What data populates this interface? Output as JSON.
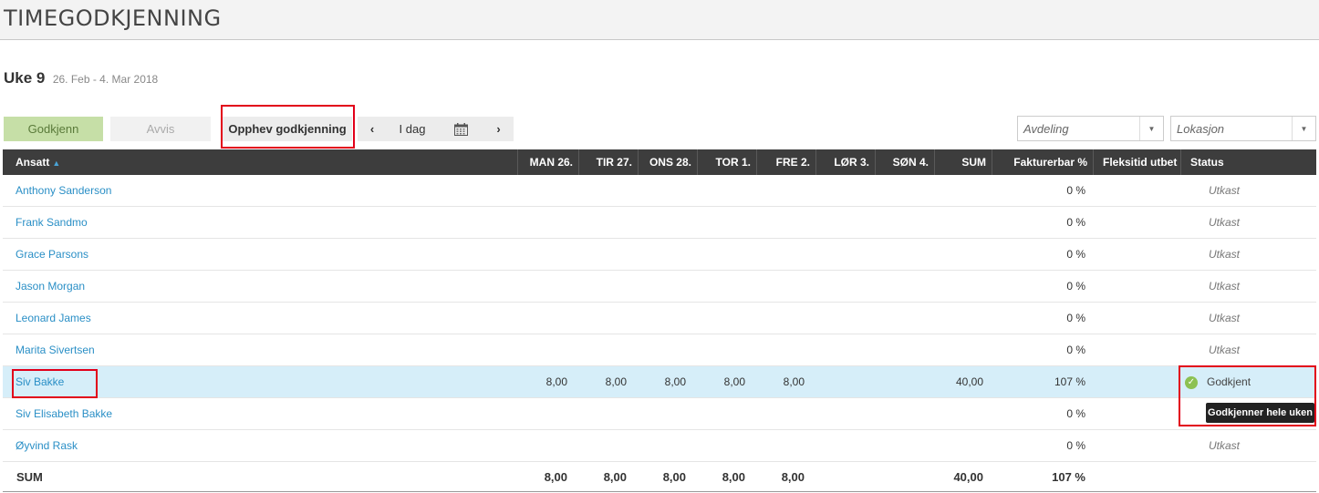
{
  "header": {
    "title": "TIMEGODKJENNING"
  },
  "week": {
    "label": "Uke 9",
    "range": "26. Feb - 4. Mar 2018"
  },
  "toolbar": {
    "approve": "Godkjenn",
    "reject": "Avvis",
    "unapprove": "Opphev godkjenning",
    "prev": "‹",
    "today": "I dag",
    "next": "›"
  },
  "filters": {
    "department_placeholder": "Avdeling",
    "location_placeholder": "Lokasjon"
  },
  "columns": {
    "employee": "Ansatt",
    "mon": "MAN 26.",
    "tue": "TIR 27.",
    "wed": "ONS 28.",
    "thu": "TOR 1.",
    "fri": "FRE 2.",
    "sat": "LØR 3.",
    "sun": "SØN 4.",
    "sum": "SUM",
    "billable": "Fakturerbar %",
    "flex": "Fleksitid utbet",
    "status": "Status"
  },
  "rows": [
    {
      "name": "Anthony Sanderson",
      "mon": "",
      "tue": "",
      "wed": "",
      "thu": "",
      "fri": "",
      "sum": "",
      "billable": "0 %",
      "status": "Utkast"
    },
    {
      "name": "Frank Sandmo",
      "mon": "",
      "tue": "",
      "wed": "",
      "thu": "",
      "fri": "",
      "sum": "",
      "billable": "0 %",
      "status": "Utkast"
    },
    {
      "name": "Grace Parsons",
      "mon": "",
      "tue": "",
      "wed": "",
      "thu": "",
      "fri": "",
      "sum": "",
      "billable": "0 %",
      "status": "Utkast"
    },
    {
      "name": "Jason Morgan",
      "mon": "",
      "tue": "",
      "wed": "",
      "thu": "",
      "fri": "",
      "sum": "",
      "billable": "0 %",
      "status": "Utkast"
    },
    {
      "name": "Leonard James",
      "mon": "",
      "tue": "",
      "wed": "",
      "thu": "",
      "fri": "",
      "sum": "",
      "billable": "0 %",
      "status": "Utkast"
    },
    {
      "name": "Marita Sivertsen",
      "mon": "",
      "tue": "",
      "wed": "",
      "thu": "",
      "fri": "",
      "sum": "",
      "billable": "0 %",
      "status": "Utkast"
    },
    {
      "name": "Siv Bakke",
      "mon": "8,00",
      "tue": "8,00",
      "wed": "8,00",
      "thu": "8,00",
      "fri": "8,00",
      "sum": "40,00",
      "billable": "107 %",
      "status": "Godkjent"
    },
    {
      "name": "Siv Elisabeth Bakke",
      "mon": "",
      "tue": "",
      "wed": "",
      "thu": "",
      "fri": "",
      "sum": "",
      "billable": "0 %",
      "status": ""
    },
    {
      "name": "Øyvind Rask",
      "mon": "",
      "tue": "",
      "wed": "",
      "thu": "",
      "fri": "",
      "sum": "",
      "billable": "0 %",
      "status": "Utkast"
    }
  ],
  "totals": {
    "label": "SUM",
    "mon": "8,00",
    "tue": "8,00",
    "wed": "8,00",
    "thu": "8,00",
    "fri": "8,00",
    "sum": "40,00",
    "billable": "107 %"
  },
  "tooltip": {
    "text": "Godkjenner hele uken"
  },
  "colors": {
    "accent": "#2a8fc6",
    "approved": "#8cc152",
    "header_bg": "#3d3d3d",
    "highlight": "#e2001a",
    "selected_row": "#d6eef9"
  }
}
